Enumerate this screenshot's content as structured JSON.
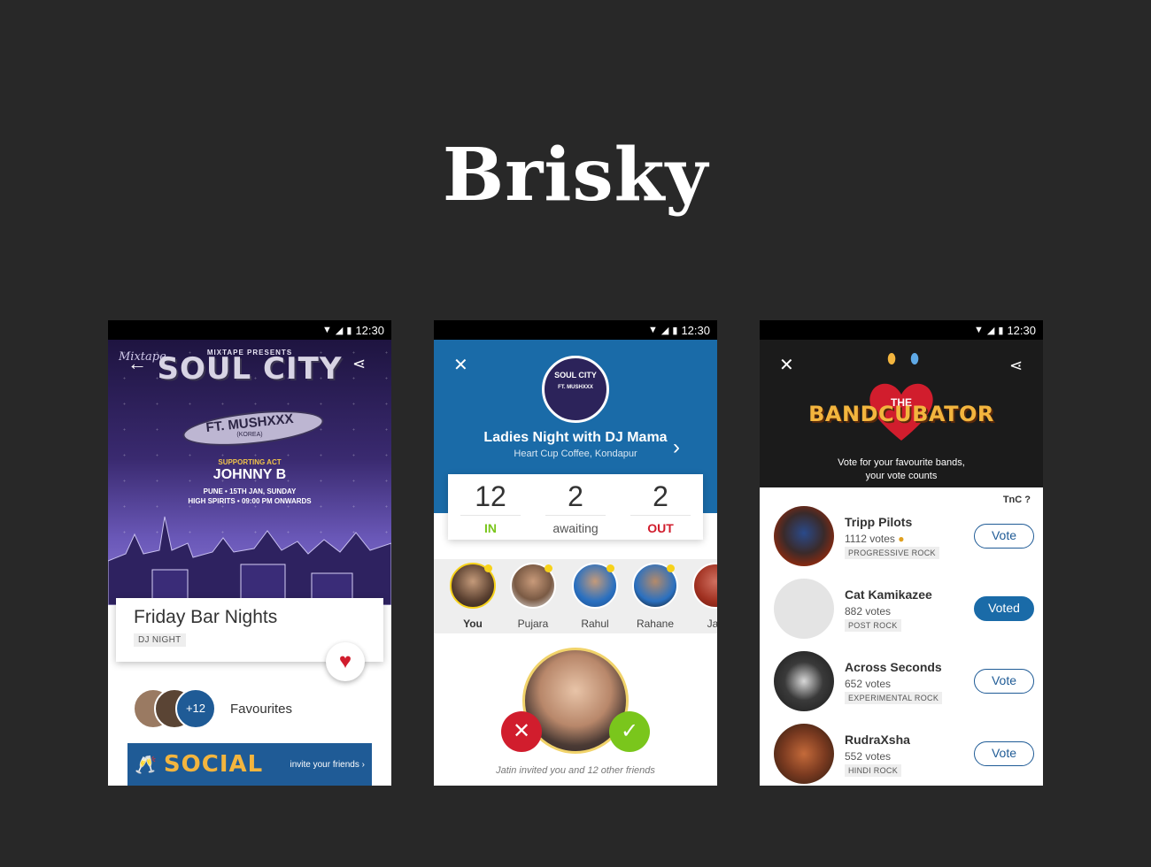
{
  "title": "Brisky",
  "status_time": "12:30",
  "phone1": {
    "poster": {
      "mixtape": "Mixtape",
      "presents": "MIXTAPE PRESENTS",
      "soul_city": "SOUL CITY",
      "ft": "FT. MUSHXXX",
      "korea": "(KOREA)",
      "supporting": "SUPPORTING ACT",
      "johnny": "JOHNNY B",
      "line1": "PUNE • 15TH JAN, SUNDAY",
      "line2": "HIGH SPIRITS • 09:00 PM ONWARDS"
    },
    "event_name": "Friday Bar Nights",
    "event_tag": "DJ NIGHT",
    "favourites_count": "+12",
    "favourites_label": "Favourites",
    "social_word": "SOCIAL",
    "social_cta": "invite your friends"
  },
  "phone2": {
    "logo_text": "SOUL CITY",
    "logo_sub": "FT. MUSHXXX",
    "event_title": "Ladies Night with DJ Mama",
    "venue": "Heart Cup Coffee, Kondapur",
    "stats": {
      "in_count": "12",
      "in_label": "IN",
      "awaiting_count": "2",
      "awaiting_label": "awaiting",
      "out_count": "2",
      "out_label": "OUT"
    },
    "friends": [
      {
        "name": "You"
      },
      {
        "name": "Pujara"
      },
      {
        "name": "Rahul"
      },
      {
        "name": "Rahane"
      },
      {
        "name": "Jac"
      }
    ],
    "invite_text": "Jatin invited you and 12 other friends"
  },
  "phone3": {
    "logo_the": "THE",
    "logo_main": "BANDCUBATOR",
    "subtitle_line1": "Vote for your favourite bands,",
    "subtitle_line2": "your vote counts",
    "tnc": "TnC",
    "bands": [
      {
        "name": "Tripp Pilots",
        "votes": "1112 votes",
        "genre": "PROGRESSIVE ROCK",
        "button": "Vote"
      },
      {
        "name": "Cat Kamikazee",
        "votes": "882 votes",
        "genre": "POST ROCK",
        "button": "Voted"
      },
      {
        "name": "Across Seconds",
        "votes": "652 votes",
        "genre": "EXPERIMENTAL ROCK",
        "button": "Vote"
      },
      {
        "name": "RudraXsha",
        "votes": "552 votes",
        "genre": "HINDI ROCK",
        "button": "Vote"
      }
    ]
  }
}
